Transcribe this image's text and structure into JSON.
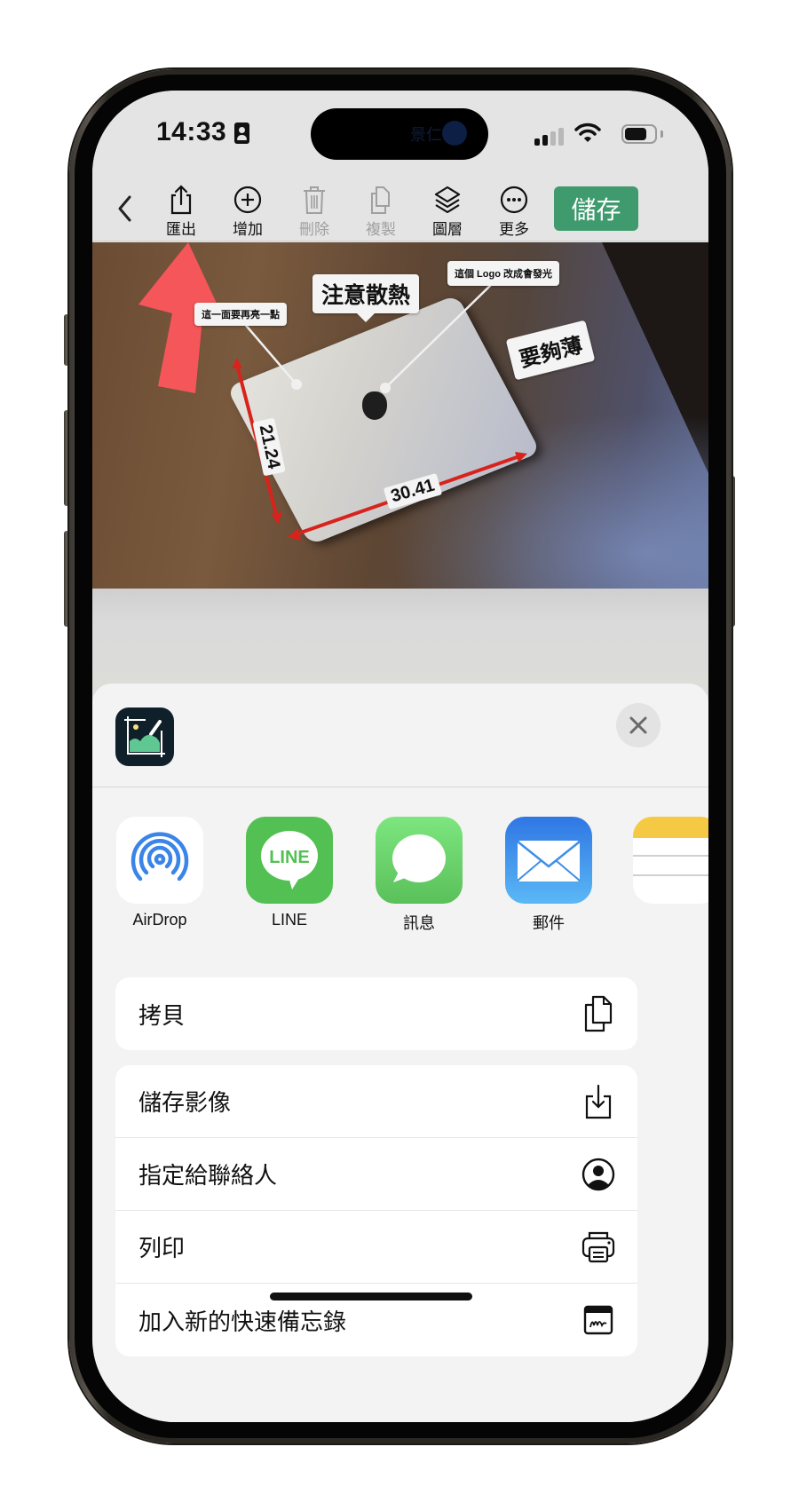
{
  "status_bar": {
    "time": "14:33",
    "island_text": "景仁",
    "cellular_bars_active": 2,
    "cellular_bars_total": 4,
    "battery_level": 0.7
  },
  "toolbar": {
    "back_label": "‹",
    "tools": [
      {
        "id": "export",
        "label": "匯出",
        "icon": "share-icon",
        "enabled": true
      },
      {
        "id": "add",
        "label": "增加",
        "icon": "plus-circle-icon",
        "enabled": true
      },
      {
        "id": "delete",
        "label": "刪除",
        "icon": "trash-icon",
        "enabled": false
      },
      {
        "id": "duplicate",
        "label": "複製",
        "icon": "duplicate-icon",
        "enabled": false
      },
      {
        "id": "layers",
        "label": "圖層",
        "icon": "layers-icon",
        "enabled": true
      },
      {
        "id": "more",
        "label": "更多",
        "icon": "more-circle-icon",
        "enabled": true
      }
    ],
    "save_label": "儲存",
    "save_color": "#3f9a6e"
  },
  "photo": {
    "annotations": [
      {
        "id": "brighter",
        "text": "這一面要再亮一點"
      },
      {
        "id": "heat",
        "text": "注意散熱"
      },
      {
        "id": "logo",
        "text": "這個 Logo 改成會發光"
      },
      {
        "id": "thin",
        "text": "要夠薄"
      }
    ],
    "dimensions": {
      "height": "21.24",
      "width": "30.41"
    },
    "arrow_color": "#f5565a",
    "dimension_color": "#d8231d"
  },
  "share_sheet": {
    "close_label": "✕",
    "apps": [
      {
        "id": "airdrop",
        "label": "AirDrop"
      },
      {
        "id": "line",
        "label": "LINE",
        "tile_text": "LINE"
      },
      {
        "id": "messages",
        "label": "訊息"
      },
      {
        "id": "mail",
        "label": "郵件"
      }
    ],
    "actions_group_1": [
      {
        "id": "copy",
        "label": "拷貝",
        "icon": "copy-icon"
      }
    ],
    "actions_group_2": [
      {
        "id": "save-image",
        "label": "儲存影像",
        "icon": "download-icon"
      },
      {
        "id": "assign-contact",
        "label": "指定給聯絡人",
        "icon": "contact-icon"
      },
      {
        "id": "print",
        "label": "列印",
        "icon": "printer-icon"
      },
      {
        "id": "quick-note",
        "label": "加入新的快速備忘錄",
        "icon": "quick-note-icon"
      }
    ]
  }
}
